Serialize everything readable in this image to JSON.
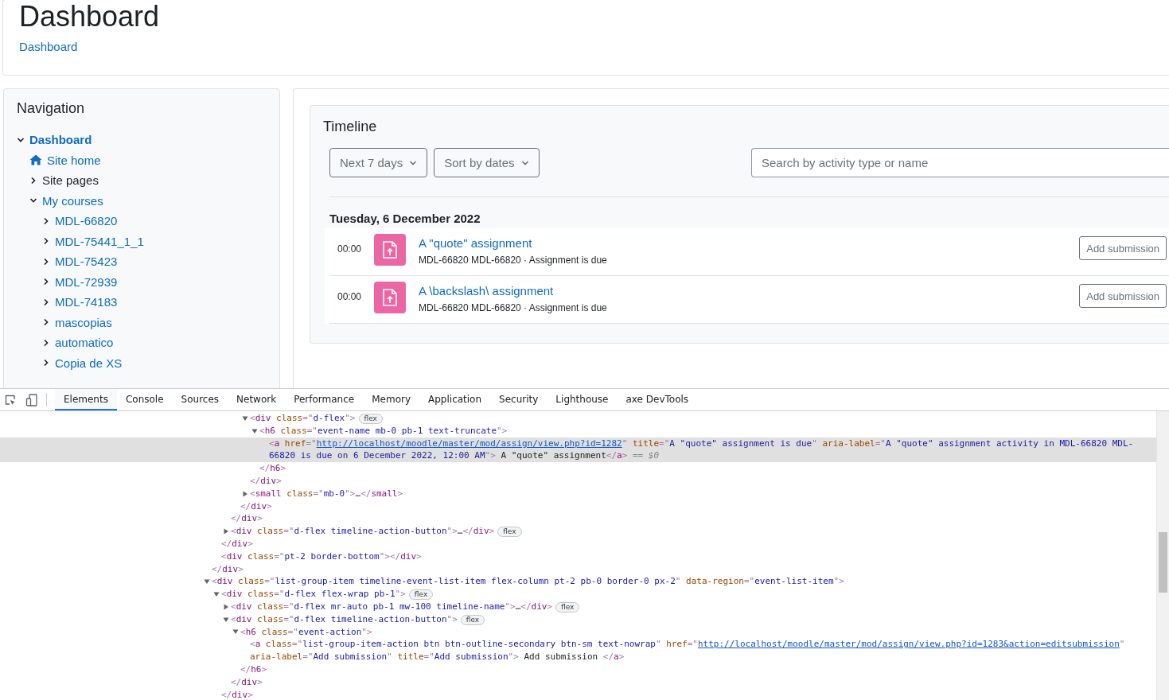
{
  "header": {
    "title": "Dashboard",
    "breadcrumb": "Dashboard"
  },
  "navigation": {
    "title": "Navigation",
    "items": [
      {
        "label": "Dashboard",
        "kind": "branch",
        "expanded": true,
        "active": true,
        "is_link": true,
        "children": [
          {
            "label": "Site home",
            "kind": "home",
            "active": false,
            "is_link": true
          },
          {
            "label": "Site pages",
            "kind": "branch",
            "expanded": false,
            "active": false,
            "is_link": false
          },
          {
            "label": "My courses",
            "kind": "branch",
            "expanded": true,
            "active": false,
            "is_link": true,
            "children": [
              {
                "label": "MDL-66820",
                "kind": "branch",
                "expanded": false,
                "active": false,
                "is_link": true
              },
              {
                "label": "MDL-75441_1_1",
                "kind": "branch",
                "expanded": false,
                "active": false,
                "is_link": true
              },
              {
                "label": "MDL-75423",
                "kind": "branch",
                "expanded": false,
                "active": false,
                "is_link": true
              },
              {
                "label": "MDL-72939",
                "kind": "branch",
                "expanded": false,
                "active": false,
                "is_link": true
              },
              {
                "label": "MDL-74183",
                "kind": "branch",
                "expanded": false,
                "active": false,
                "is_link": true
              },
              {
                "label": "mascopias",
                "kind": "branch",
                "expanded": false,
                "active": false,
                "is_link": true
              },
              {
                "label": "automatico",
                "kind": "branch",
                "expanded": false,
                "active": false,
                "is_link": true
              },
              {
                "label": "Copia de XS",
                "kind": "branch",
                "expanded": false,
                "active": false,
                "is_link": true
              }
            ]
          }
        ]
      }
    ]
  },
  "timeline": {
    "title": "Timeline",
    "filters": [
      "Next 7 days",
      "Sort by dates"
    ],
    "search": {
      "placeholder": "Search by activity type or name"
    },
    "date_heading": "Tuesday, 6 December 2022",
    "events": [
      {
        "time": "00:00",
        "title": "A \"quote\" assignment",
        "details": "MDL-66820 MDL-66820 · Assignment is due",
        "action": "Add submission"
      },
      {
        "time": "00:00",
        "title": "A \\backslash\\ assignment",
        "details": "MDL-66820 MDL-66820 · Assignment is due",
        "action": "Add submission"
      }
    ]
  },
  "devtools": {
    "tabs": [
      {
        "label": "Elements",
        "selected": true
      },
      {
        "label": "Console",
        "selected": false
      },
      {
        "label": "Sources",
        "selected": false
      },
      {
        "label": "Network",
        "selected": false
      },
      {
        "label": "Performance",
        "selected": false
      },
      {
        "label": "Memory",
        "selected": false
      },
      {
        "label": "Application",
        "selected": false
      },
      {
        "label": "Security",
        "selected": false
      },
      {
        "label": "Lighthouse",
        "selected": false
      },
      {
        "label": "axe DevTools",
        "selected": false
      }
    ],
    "dom_tree": [
      {
        "close": [
          {
            "kind": "punct",
            "text": "</"
          },
          {
            "kind": "tag",
            "text": "div"
          },
          {
            "kind": "punct",
            "text": ">"
          }
        ],
        "children": [
          {
            "close": [
              {
                "kind": "punct",
                "text": "</"
              },
              {
                "kind": "tag",
                "text": "div"
              },
              {
                "kind": "punct",
                "text": ">"
              }
            ],
            "children": [
              {
                "close": [
                  {
                    "kind": "punct",
                    "text": "</"
                  },
                  {
                    "kind": "tag",
                    "text": "div"
                  },
                  {
                    "kind": "punct",
                    "text": ">"
                  }
                ],
                "children": [
                  {
                    "close": [
                      {
                        "kind": "punct",
                        "text": "</"
                      },
                      {
                        "kind": "tag",
                        "text": "div"
                      },
                      {
                        "kind": "punct",
                        "text": ">"
                      }
                    ],
                    "children": [
                      {
                        "selected": false,
                        "expanded": true,
                        "badge": "flex",
                        "open": [
                          {
                            "kind": "punct",
                            "text": "<"
                          },
                          {
                            "kind": "tag",
                            "text": "div"
                          },
                          {
                            "kind": "attr",
                            "text": " class"
                          },
                          {
                            "kind": "punct",
                            "text": "=\""
                          },
                          {
                            "kind": "value",
                            "text": "d-flex"
                          },
                          {
                            "kind": "punct",
                            "text": "\">"
                          }
                        ],
                        "close": [
                          {
                            "kind": "punct",
                            "text": "</"
                          },
                          {
                            "kind": "tag",
                            "text": "div"
                          },
                          {
                            "kind": "punct",
                            "text": ">"
                          }
                        ],
                        "children": [
                          {
                            "selected": false,
                            "expanded": true,
                            "open": [
                              {
                                "kind": "punct",
                                "text": "<"
                              },
                              {
                                "kind": "tag",
                                "text": "h6"
                              },
                              {
                                "kind": "attr",
                                "text": " class"
                              },
                              {
                                "kind": "punct",
                                "text": "=\""
                              },
                              {
                                "kind": "value",
                                "text": "event-name mb-0 pb-1 text-truncate"
                              },
                              {
                                "kind": "punct",
                                "text": "\">"
                              }
                            ],
                            "close": [
                              {
                                "kind": "punct",
                                "text": "</"
                              },
                              {
                                "kind": "tag",
                                "text": "h6"
                              },
                              {
                                "kind": "punct",
                                "text": ">"
                              }
                            ],
                            "children": [
                              {
                                "selected": true,
                                "hint": "== $0",
                                "open": [
                                  {
                                    "kind": "punct",
                                    "text": "<"
                                  },
                                  {
                                    "kind": "tag",
                                    "text": "a"
                                  },
                                  {
                                    "kind": "attr",
                                    "text": " href"
                                  },
                                  {
                                    "kind": "punct",
                                    "text": "=\""
                                  },
                                  {
                                    "kind": "link",
                                    "text": "http://localhost/moodle/master/mod/assign/view.php?id=1282"
                                  },
                                  {
                                    "kind": "punct",
                                    "text": "\" "
                                  },
                                  {
                                    "kind": "attr",
                                    "text": "title"
                                  },
                                  {
                                    "kind": "punct",
                                    "text": "=\""
                                  },
                                  {
                                    "kind": "value",
                                    "text": "A \"quote\" assignment is due"
                                  },
                                  {
                                    "kind": "punct",
                                    "text": "\" "
                                  },
                                  {
                                    "kind": "attr",
                                    "text": "aria-label"
                                  },
                                  {
                                    "kind": "punct",
                                    "text": "=\""
                                  },
                                  {
                                    "kind": "value",
                                    "text": "A \"quote\" assignment activity in MDL-66820 MDL-66820 is due on 6 December 2022, 12:00 AM"
                                  },
                                  {
                                    "kind": "punct",
                                    "text": "\">"
                                  },
                                  {
                                    "kind": "text",
                                    "text": " A \"quote\" assignment"
                                  },
                                  {
                                    "kind": "punct",
                                    "text": "</"
                                  },
                                  {
                                    "kind": "tag",
                                    "text": "a"
                                  },
                                  {
                                    "kind": "punct",
                                    "text": ">"
                                  }
                                ]
                              }
                            ]
                          }
                        ]
                      },
                      {
                        "selected": false,
                        "expanded": false,
                        "open": [
                          {
                            "kind": "punct",
                            "text": "<"
                          },
                          {
                            "kind": "tag",
                            "text": "small"
                          },
                          {
                            "kind": "attr",
                            "text": " class"
                          },
                          {
                            "kind": "punct",
                            "text": "=\""
                          },
                          {
                            "kind": "value",
                            "text": "mb-0"
                          },
                          {
                            "kind": "punct",
                            "text": "\">"
                          },
                          {
                            "kind": "text",
                            "text": "…"
                          },
                          {
                            "kind": "punct",
                            "text": "</"
                          },
                          {
                            "kind": "tag",
                            "text": "small"
                          },
                          {
                            "kind": "punct",
                            "text": ">"
                          }
                        ]
                      }
                    ]
                  }
                ]
              },
              {
                "selected": false,
                "expanded": false,
                "badge": "flex",
                "open": [
                  {
                    "kind": "punct",
                    "text": "<"
                  },
                  {
                    "kind": "tag",
                    "text": "div"
                  },
                  {
                    "kind": "attr",
                    "text": " class"
                  },
                  {
                    "kind": "punct",
                    "text": "=\""
                  },
                  {
                    "kind": "value",
                    "text": "d-flex timeline-action-button"
                  },
                  {
                    "kind": "punct",
                    "text": "\">"
                  },
                  {
                    "kind": "text",
                    "text": "…"
                  },
                  {
                    "kind": "punct",
                    "text": "</"
                  },
                  {
                    "kind": "tag",
                    "text": "div"
                  },
                  {
                    "kind": "punct",
                    "text": ">"
                  }
                ]
              }
            ]
          },
          {
            "selected": false,
            "open": [
              {
                "kind": "punct",
                "text": "<"
              },
              {
                "kind": "tag",
                "text": "div"
              },
              {
                "kind": "attr",
                "text": " class"
              },
              {
                "kind": "punct",
                "text": "=\""
              },
              {
                "kind": "value",
                "text": "pt-2 border-bottom"
              },
              {
                "kind": "punct",
                "text": "\"></"
              },
              {
                "kind": "tag",
                "text": "div"
              },
              {
                "kind": "punct",
                "text": ">"
              }
            ]
          }
        ]
      },
      {
        "selected": false,
        "expanded": true,
        "open": [
          {
            "kind": "punct",
            "text": "<"
          },
          {
            "kind": "tag",
            "text": "div"
          },
          {
            "kind": "attr",
            "text": " class"
          },
          {
            "kind": "punct",
            "text": "=\""
          },
          {
            "kind": "value",
            "text": "list-group-item timeline-event-list-item flex-column pt-2 pb-0 border-0 px-2"
          },
          {
            "kind": "punct",
            "text": "\" "
          },
          {
            "kind": "attr",
            "text": "data-region"
          },
          {
            "kind": "punct",
            "text": "=\""
          },
          {
            "kind": "value",
            "text": "event-list-item"
          },
          {
            "kind": "punct",
            "text": "\">"
          }
        ],
        "children": [
          {
            "selected": false,
            "expanded": true,
            "badge": "flex",
            "open": [
              {
                "kind": "punct",
                "text": "<"
              },
              {
                "kind": "tag",
                "text": "div"
              },
              {
                "kind": "attr",
                "text": " class"
              },
              {
                "kind": "punct",
                "text": "=\""
              },
              {
                "kind": "value",
                "text": "d-flex flex-wrap pb-1"
              },
              {
                "kind": "punct",
                "text": "\">"
              }
            ],
            "close": [
              {
                "kind": "punct",
                "text": "</"
              },
              {
                "kind": "tag",
                "text": "div"
              },
              {
                "kind": "punct",
                "text": ">"
              }
            ],
            "children": [
              {
                "selected": false,
                "expanded": false,
                "badge": "flex",
                "open": [
                  {
                    "kind": "punct",
                    "text": "<"
                  },
                  {
                    "kind": "tag",
                    "text": "div"
                  },
                  {
                    "kind": "attr",
                    "text": " class"
                  },
                  {
                    "kind": "punct",
                    "text": "=\""
                  },
                  {
                    "kind": "value",
                    "text": "d-flex mr-auto pb-1 mw-100 timeline-name"
                  },
                  {
                    "kind": "punct",
                    "text": "\">"
                  },
                  {
                    "kind": "text",
                    "text": "…"
                  },
                  {
                    "kind": "punct",
                    "text": "</"
                  },
                  {
                    "kind": "tag",
                    "text": "div"
                  },
                  {
                    "kind": "punct",
                    "text": ">"
                  }
                ]
              },
              {
                "selected": false,
                "expanded": true,
                "badge": "flex",
                "open": [
                  {
                    "kind": "punct",
                    "text": "<"
                  },
                  {
                    "kind": "tag",
                    "text": "div"
                  },
                  {
                    "kind": "attr",
                    "text": " class"
                  },
                  {
                    "kind": "punct",
                    "text": "=\""
                  },
                  {
                    "kind": "value",
                    "text": "d-flex timeline-action-button"
                  },
                  {
                    "kind": "punct",
                    "text": "\">"
                  }
                ],
                "close": [
                  {
                    "kind": "punct",
                    "text": "</"
                  },
                  {
                    "kind": "tag",
                    "text": "div"
                  },
                  {
                    "kind": "punct",
                    "text": ">"
                  }
                ],
                "children": [
                  {
                    "selected": false,
                    "expanded": true,
                    "open": [
                      {
                        "kind": "punct",
                        "text": "<"
                      },
                      {
                        "kind": "tag",
                        "text": "h6"
                      },
                      {
                        "kind": "attr",
                        "text": " class"
                      },
                      {
                        "kind": "punct",
                        "text": "=\""
                      },
                      {
                        "kind": "value",
                        "text": "event-action"
                      },
                      {
                        "kind": "punct",
                        "text": "\">"
                      }
                    ],
                    "close": [
                      {
                        "kind": "punct",
                        "text": "</"
                      },
                      {
                        "kind": "tag",
                        "text": "h6"
                      },
                      {
                        "kind": "punct",
                        "text": ">"
                      }
                    ],
                    "children": [
                      {
                        "selected": false,
                        "open": [
                          {
                            "kind": "punct",
                            "text": "<"
                          },
                          {
                            "kind": "tag",
                            "text": "a"
                          },
                          {
                            "kind": "attr",
                            "text": " class"
                          },
                          {
                            "kind": "punct",
                            "text": "=\""
                          },
                          {
                            "kind": "value",
                            "text": "list-group-item-action btn btn-outline-secondary btn-sm text-nowrap"
                          },
                          {
                            "kind": "punct",
                            "text": "\" "
                          },
                          {
                            "kind": "attr",
                            "text": "href"
                          },
                          {
                            "kind": "punct",
                            "text": "=\""
                          },
                          {
                            "kind": "link",
                            "text": "http://localhost/moodle/master/mod/assign/view.php?id=1283&action=editsubmission"
                          },
                          {
                            "kind": "punct",
                            "text": "\" "
                          },
                          {
                            "kind": "attr",
                            "text": "aria-label"
                          },
                          {
                            "kind": "punct",
                            "text": "=\""
                          },
                          {
                            "kind": "value",
                            "text": "Add submission"
                          },
                          {
                            "kind": "punct",
                            "text": "\" "
                          },
                          {
                            "kind": "attr",
                            "text": "title"
                          },
                          {
                            "kind": "punct",
                            "text": "=\""
                          },
                          {
                            "kind": "value",
                            "text": "Add submission"
                          },
                          {
                            "kind": "punct",
                            "text": "\">"
                          },
                          {
                            "kind": "text",
                            "text": " Add submission "
                          },
                          {
                            "kind": "punct",
                            "text": "</"
                          },
                          {
                            "kind": "tag",
                            "text": "a"
                          },
                          {
                            "kind": "punct",
                            "text": ">"
                          }
                        ]
                      }
                    ]
                  }
                ]
              }
            ]
          }
        ]
      }
    ]
  }
}
